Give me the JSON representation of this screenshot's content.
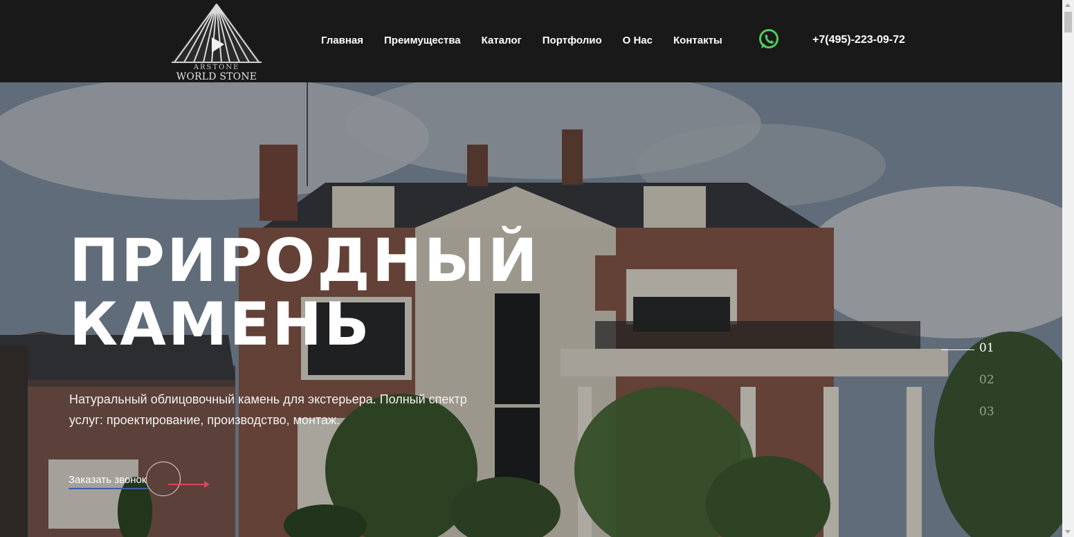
{
  "header": {
    "logo": {
      "top_text": "ARSTONE",
      "bottom_text": "WORLD STONE"
    },
    "nav": [
      "Главная",
      "Преимущества",
      "Каталог",
      "Портфолио",
      "О Нас",
      "Контакты"
    ],
    "phone": "+7(495)-223-09-72",
    "whatsapp_icon": "whatsapp-icon",
    "whatsapp_color": "#4fce5d"
  },
  "hero": {
    "title": "ПРИРОДНЫЙ\nКАМЕНЬ",
    "subtitle": "Натуральный облицовочный камень для экстерьера. Полный спектр услуг: проектирование, производство, монтаж.",
    "cta": "Заказать звонок",
    "cta_accent": "#e2435f",
    "slides": [
      "01",
      "02",
      "03"
    ],
    "active_slide": "01"
  }
}
